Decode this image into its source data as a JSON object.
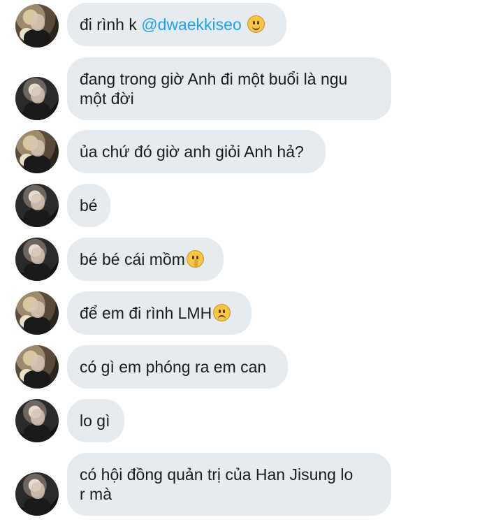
{
  "messages": [
    {
      "sender": "a",
      "parts": [
        "đi rình k ",
        "@dwaekkiseo",
        " "
      ],
      "emoji": "slightly-smiling-face-icon"
    },
    {
      "sender": "b",
      "line1": "đang trong giờ Anh đi một buổi là ngu",
      "line2": "một đời"
    },
    {
      "sender": "a",
      "text": "ủa chứ đó giờ anh giỏi Anh hả?"
    },
    {
      "sender": "b",
      "text": "bé"
    },
    {
      "sender": "b",
      "text": "bé bé cái mồm",
      "emoji": "shushing-face-icon"
    },
    {
      "sender": "a",
      "text": "để em đi rình LMH",
      "emoji": "worried-face-icon"
    },
    {
      "sender": "a",
      "text": "có gì em phóng ra em can"
    },
    {
      "sender": "b",
      "text": "lo gì"
    },
    {
      "sender": "b",
      "line1": "có hội đồng quản trị của Han Jisung lo",
      "line2": "r mà"
    }
  ]
}
